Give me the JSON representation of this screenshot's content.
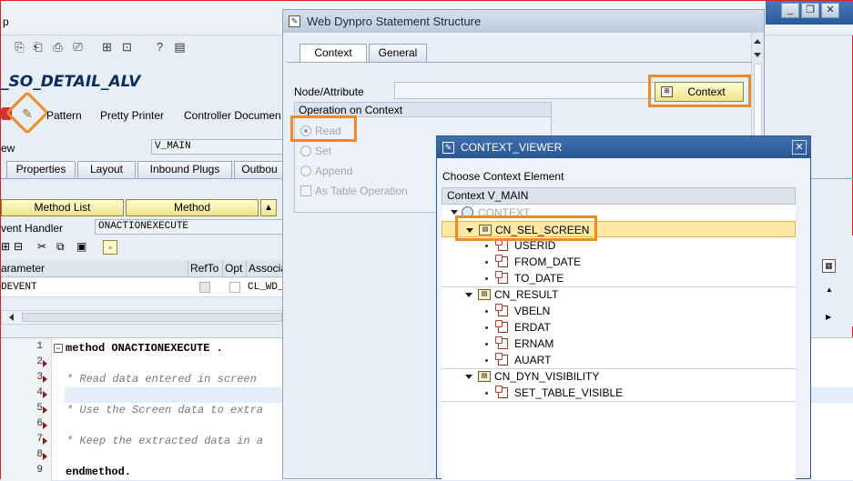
{
  "main": {
    "menu_fragment": "p",
    "title": "_SO_DETAIL_ALV",
    "toolbar_items": [
      "Pattern",
      "Pretty Printer",
      "Controller Documen"
    ],
    "view_label": "ew",
    "view_value": "V_MAIN",
    "tabs": [
      "Properties",
      "Layout",
      "Inbound Plugs",
      "Outbou"
    ],
    "method_list_label": "Method List",
    "method_label": "Method",
    "event_handler_label": "vent Handler",
    "event_handler_value": "ONACTIONEXECUTE",
    "grid_headers": [
      "arameter",
      "RefTo",
      "Opt",
      "Associa"
    ],
    "grid_row": [
      "DEVENT",
      "CL_WD_"
    ],
    "code_lines": [
      {
        "n": "1",
        "text": "method ONACTIONEXECUTE .",
        "kind": "kw"
      },
      {
        "n": "2",
        "text": "",
        "kind": "plain"
      },
      {
        "n": "3",
        "text": "* Read data entered in screen",
        "kind": "cmt"
      },
      {
        "n": "4",
        "text": "",
        "kind": "plain"
      },
      {
        "n": "5",
        "text": "* Use the Screen data to extra",
        "kind": "cmt"
      },
      {
        "n": "6",
        "text": "",
        "kind": "plain"
      },
      {
        "n": "7",
        "text": "* Keep the extracted data in a",
        "kind": "cmt"
      },
      {
        "n": "8",
        "text": "",
        "kind": "plain"
      },
      {
        "n": "9",
        "text": "endmethod.",
        "kind": "kw"
      }
    ]
  },
  "wd_dialog": {
    "title": "Web Dynpro Statement Structure",
    "tabs": [
      "Context",
      "General"
    ],
    "node_attr_label": "Node/Attribute",
    "context_button": "Context",
    "group_title": "Operation on Context",
    "radios": [
      "Read",
      "Set",
      "Append"
    ],
    "checkbox": "As Table Operation"
  },
  "context_viewer": {
    "title": "CONTEXT_VIEWER",
    "prompt": "Choose Context Element",
    "header": "Context V_MAIN",
    "root": "CONTEXT",
    "nodes": [
      {
        "name": "CN_SEL_SCREEN",
        "selected": true,
        "attrs": [
          "USERID",
          "FROM_DATE",
          "TO_DATE"
        ]
      },
      {
        "name": "CN_RESULT",
        "selected": false,
        "attrs": [
          "VBELN",
          "ERDAT",
          "ERNAM",
          "AUART"
        ]
      },
      {
        "name": "CN_DYN_VISIBILITY",
        "selected": false,
        "attrs": [
          "SET_TABLE_VISIBLE"
        ]
      }
    ]
  },
  "icons": [
    "minimize-icon",
    "restore-icon",
    "close-icon",
    "wand-icon",
    "context-node-icon",
    "attribute-icon"
  ],
  "colors": {
    "highlight_orange": "#f08a28",
    "selected_row": "#fde8a6",
    "title_blue": "#0a2c5c"
  }
}
